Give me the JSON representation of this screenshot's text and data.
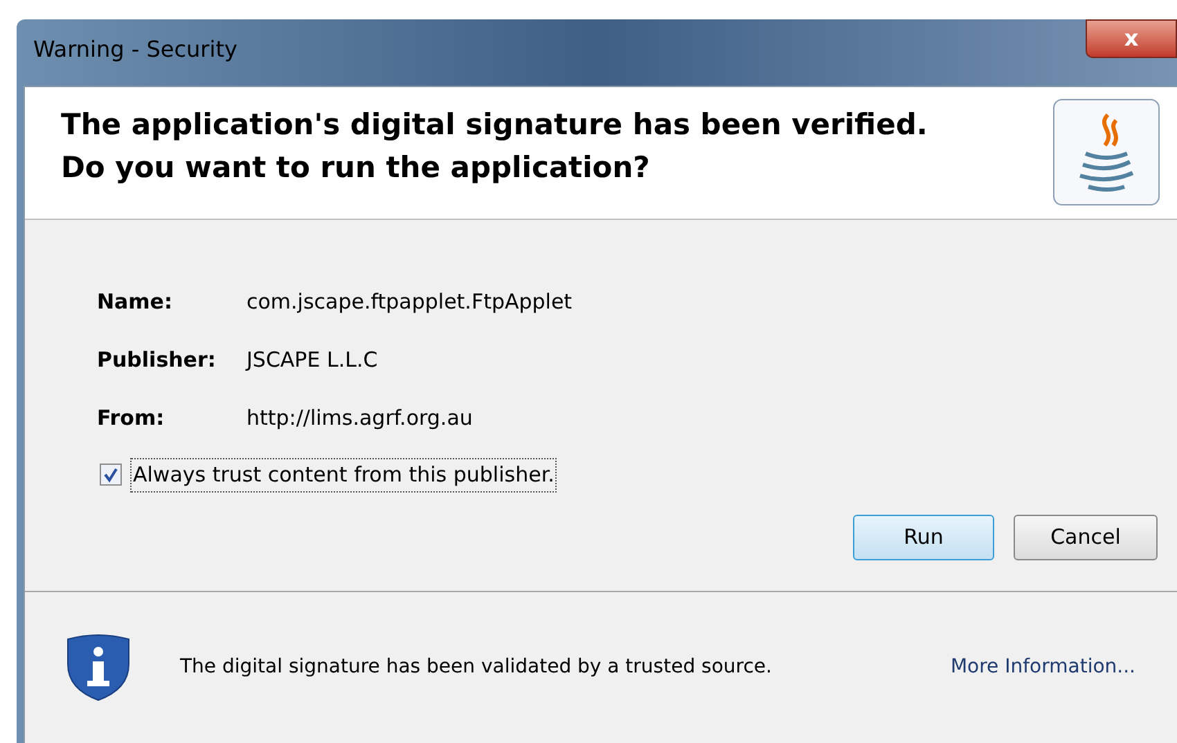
{
  "window": {
    "title": "Warning - Security",
    "close": "x"
  },
  "header": {
    "lines": [
      "The application's digital signature has been verified.",
      "Do you want to run the application?"
    ]
  },
  "details": [
    {
      "label": "Name:",
      "value": "com.jscape.ftpapplet.FtpApplet"
    },
    {
      "label": "Publisher:",
      "value": "JSCAPE L.L.C"
    },
    {
      "label": "From:",
      "value": "http://lims.agrf.org.au"
    }
  ],
  "trust": {
    "label": "Always trust content from this publisher.",
    "checked": true
  },
  "buttons": [
    {
      "label": "Run",
      "default": true
    },
    {
      "label": "Cancel",
      "default": false
    }
  ],
  "footer": {
    "message": "The digital signature has been validated by a trusted source.",
    "link": "More Information..."
  }
}
